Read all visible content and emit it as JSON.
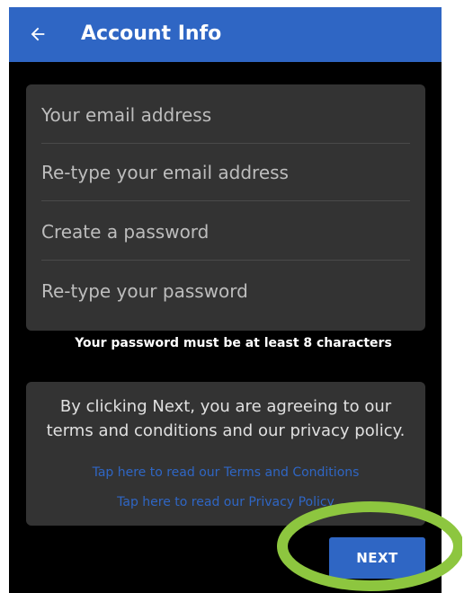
{
  "header": {
    "title": "Account Info"
  },
  "form": {
    "email_placeholder": "Your email address",
    "email_confirm_placeholder": "Re-type your email address",
    "password_placeholder": "Create a password",
    "password_confirm_placeholder": "Re-type your password",
    "email_value": "",
    "email_confirm_value": "",
    "password_value": "",
    "password_confirm_value": ""
  },
  "password_hint": "Your password must be at least 8 characters",
  "terms": {
    "notice": "By clicking Next, you are agreeing to our terms and conditions and our privacy policy.",
    "terms_link": "Tap here to read our Terms and Conditions",
    "privacy_link": "Tap here to read our Privacy Policy"
  },
  "actions": {
    "next_label": "NEXT"
  },
  "colors": {
    "primary": "#2f66c4",
    "background": "#000000",
    "card": "#333333",
    "highlight_ring": "#8dc63f"
  },
  "icons": {
    "back": "arrow-left-icon"
  }
}
